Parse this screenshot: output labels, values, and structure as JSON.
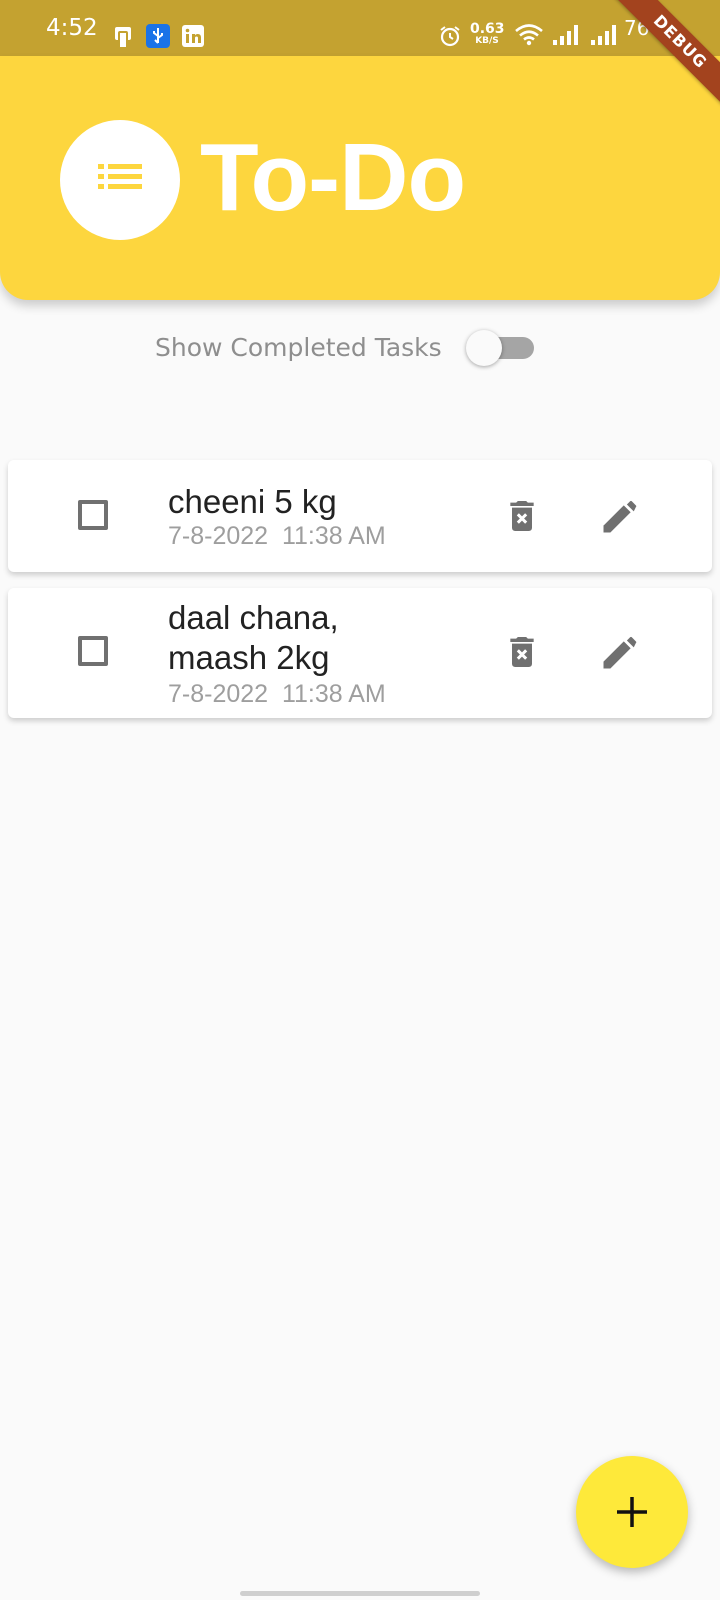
{
  "status_bar": {
    "time": "4:52",
    "net_speed_value": "0.63",
    "net_speed_unit": "KB/S",
    "battery": "76%",
    "icons": [
      "notification-icon",
      "usb-debug-icon",
      "linkedin-icon",
      "alarm-icon",
      "wifi-icon",
      "signal-icon",
      "signal-icon-2",
      "battery-charging-icon"
    ]
  },
  "debug_banner": "DEBUG",
  "header": {
    "title": "To-Do",
    "icon": "list-icon"
  },
  "filter": {
    "label": "Show Completed Tasks",
    "enabled": false
  },
  "tasks": [
    {
      "title": "cheeni 5 kg",
      "date": "7-8-2022  11:38 AM",
      "completed": false
    },
    {
      "title": "daal chana, maash 2kg",
      "date": "7-8-2022  11:38 AM",
      "completed": false
    }
  ],
  "fab": {
    "icon": "add-icon"
  },
  "colors": {
    "status_bar": "#c4a230",
    "header": "#fdd63e",
    "fab": "#fee93a",
    "icon_gray": "#707070",
    "background": "#fafafa"
  }
}
